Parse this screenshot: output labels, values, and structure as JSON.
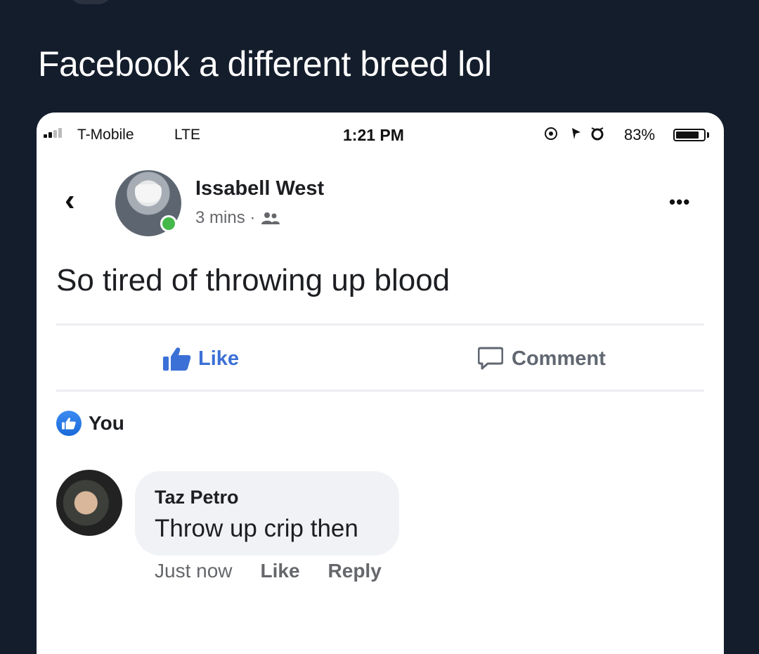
{
  "tweet": {
    "text": "Facebook a different breed lol"
  },
  "status_bar": {
    "carrier": "T-Mobile",
    "network": "LTE",
    "time": "1:21 PM",
    "battery": "83%"
  },
  "post": {
    "author": "Issabell West",
    "meta": "3 mins ·",
    "text": "So tired of throwing up blood",
    "like_label": "Like",
    "comment_label": "Comment"
  },
  "reactions": {
    "reactor": "You"
  },
  "comment": {
    "author": "Taz Petro",
    "text": "Throw up crip then",
    "time": "Just now",
    "like_label": "Like",
    "reply_label": "Reply"
  },
  "colors": {
    "background": "#141d2b",
    "link_blue": "#3b70d6",
    "online_green": "#44b94a"
  }
}
